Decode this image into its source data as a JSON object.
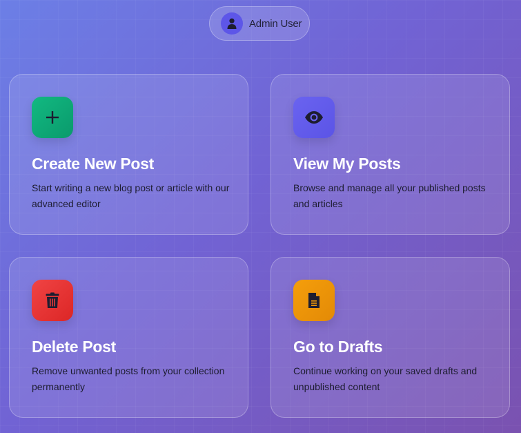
{
  "user": {
    "name": "Admin User",
    "avatar_icon": "user-icon"
  },
  "cards": [
    {
      "title": "Create New Post",
      "description": "Start writing a new blog post or article with our advanced editor",
      "icon": "plus-icon",
      "color": "#10b981"
    },
    {
      "title": "View My Posts",
      "description": "Browse and manage all your published posts and articles",
      "icon": "eye-icon",
      "color": "#6366f1"
    },
    {
      "title": "Delete Post",
      "description": "Remove unwanted posts from your collection permanently",
      "icon": "trash-icon",
      "color": "#ef4444"
    },
    {
      "title": "Go to Drafts",
      "description": "Continue working on your saved drafts and unpublished content",
      "icon": "file-icon",
      "color": "#f59e0b"
    }
  ],
  "theme": {
    "background_start": "#6c7fe6",
    "background_end": "#7a52b0"
  }
}
